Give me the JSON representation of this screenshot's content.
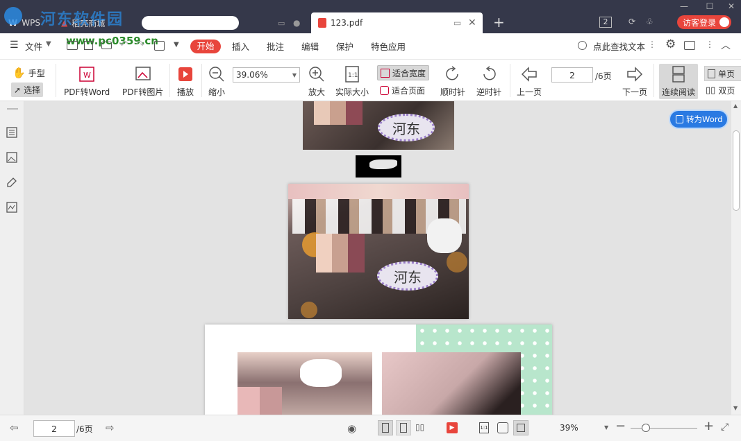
{
  "watermark": {
    "site": "河东软件园",
    "url": "www.pc0359.cn"
  },
  "tabs": [
    {
      "label": "WPS"
    },
    {
      "label": "稻壳商城"
    },
    {
      "label": "123.pdf"
    }
  ],
  "titlebar": {
    "page_count_badge": "2",
    "login_label": "访客登录"
  },
  "menu": {
    "file": "文件",
    "items": [
      "开始",
      "插入",
      "批注",
      "编辑",
      "保护",
      "特色应用"
    ],
    "search": "点此查找文本"
  },
  "toolbar": {
    "hand": "手型",
    "select": "选择",
    "pdf_to_word": "PDF转Word",
    "pdf_to_image": "PDF转图片",
    "play": "播放",
    "zoom_out": "缩小",
    "zoom_value": "39.06%",
    "zoom_in": "放大",
    "actual_size": "实际大小",
    "fit_width": "适合宽度",
    "fit_page": "适合页面",
    "clockwise": "顺时针",
    "counterclockwise": "逆时针",
    "prev_page": "上一页",
    "page_value": "2",
    "page_total": "/6页",
    "next_page": "下一页",
    "continuous": "连续阅读",
    "single": "单页",
    "double": "双页"
  },
  "convert_button": "转为Word",
  "document": {
    "bubble_text_1": "河东",
    "bubble_text_2": "河东"
  },
  "statusbar": {
    "page_value": "2",
    "page_total": "/6页",
    "zoom": "39%"
  }
}
